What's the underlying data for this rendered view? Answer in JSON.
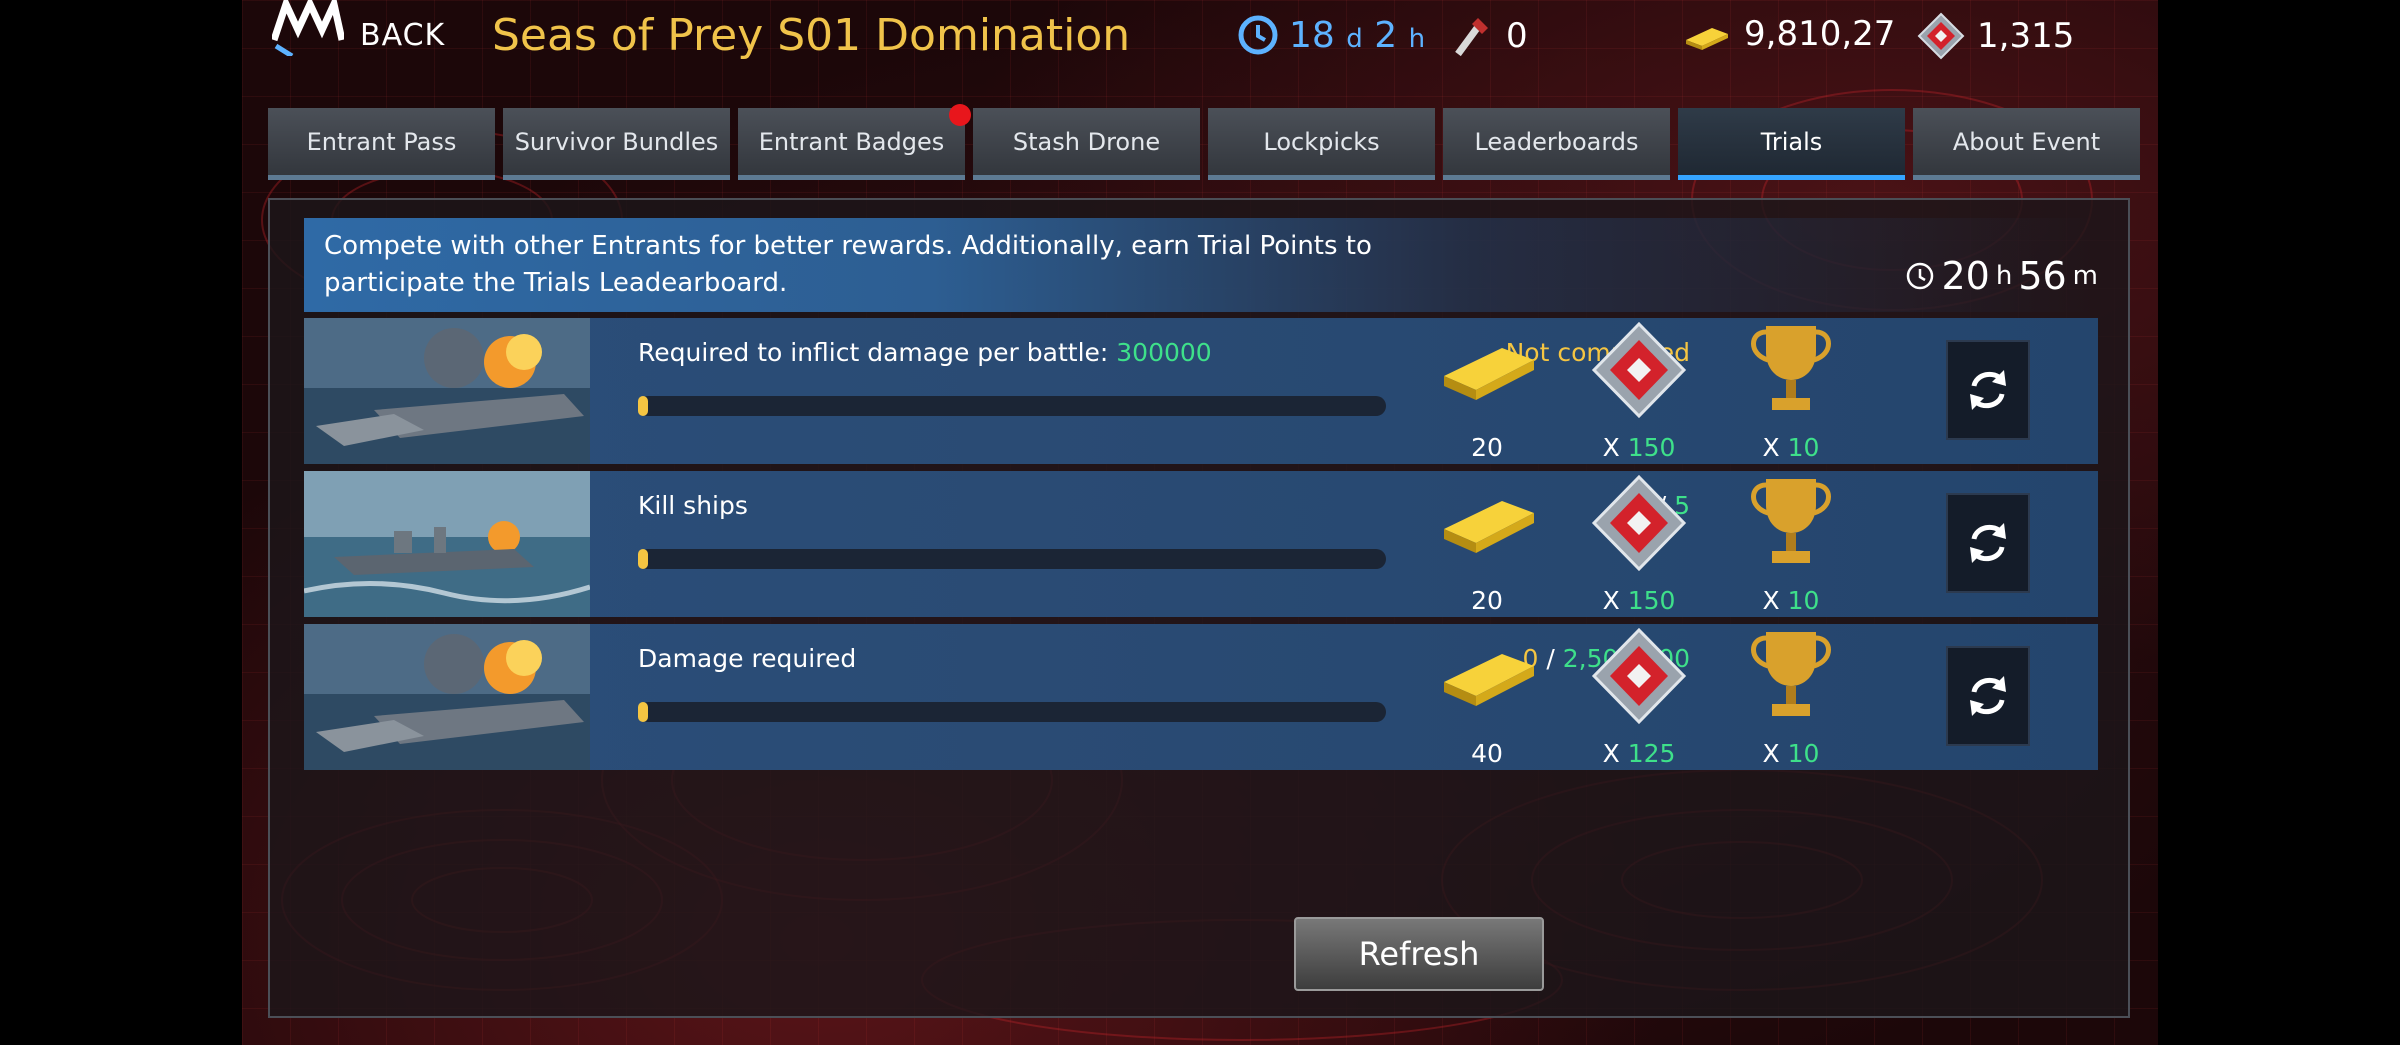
{
  "header": {
    "back_label": "BACK",
    "title": "Seas of Prey S01 Domination",
    "event_timer": {
      "days": "18",
      "d_unit": "d",
      "hours": "2",
      "h_unit": "h"
    },
    "lockpicks": "0",
    "gold": "9,810,27",
    "gems": "1,315"
  },
  "tabs": [
    {
      "label": "Entrant Pass",
      "active": false
    },
    {
      "label": "Survivor Bundles",
      "active": false
    },
    {
      "label": "Entrant Badges",
      "active": false,
      "notification": true
    },
    {
      "label": "Stash Drone",
      "active": false
    },
    {
      "label": "Lockpicks",
      "active": false
    },
    {
      "label": "Leaderboards",
      "active": false
    },
    {
      "label": "Trials",
      "active": true
    },
    {
      "label": "About Event",
      "active": false
    }
  ],
  "banner": {
    "description": "Compete with other Entrants for better rewards. Additionally, earn Trial Points to participate the Trials Leadearboard.",
    "countdown": {
      "hours": "20",
      "h_unit": "h",
      "minutes": "56",
      "m_unit": "m"
    }
  },
  "trials": [
    {
      "task": "Required to inflict damage per battle:",
      "requirement": "300000",
      "status_text": "Not completed",
      "progress": 0,
      "rewards": {
        "gold": "20",
        "gem_prefix": "X",
        "gems": "150",
        "trophy_prefix": "X",
        "trophy": "10"
      }
    },
    {
      "task": "Kill ships",
      "current": "0",
      "separator": "/",
      "target": "5",
      "progress": 0,
      "rewards": {
        "gold": "20",
        "gem_prefix": "X",
        "gems": "150",
        "trophy_prefix": "X",
        "trophy": "10"
      }
    },
    {
      "task": "Damage required",
      "current": "0",
      "separator": "/",
      "target": "2,500,000",
      "progress": 0,
      "rewards": {
        "gold": "40",
        "gem_prefix": "X",
        "gems": "125",
        "trophy_prefix": "X",
        "trophy": "10"
      }
    }
  ],
  "refresh_button": "Refresh",
  "colors": {
    "title": "#f0c34a",
    "timer": "#5db2ff",
    "active_tab_underline": "#35a4ff",
    "positive": "#3ee08a",
    "warning": "#f5c542",
    "notification": "#e8161c"
  }
}
